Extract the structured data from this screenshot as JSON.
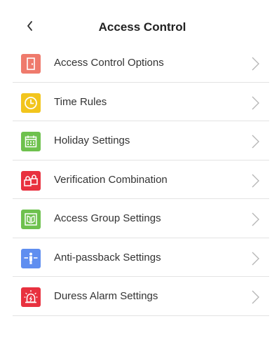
{
  "header": {
    "title": "Access Control",
    "back_icon": "chevron-left-icon"
  },
  "menu": {
    "items": [
      {
        "label": "Access Control Options",
        "icon": "door-icon",
        "color": "#ef7a6c"
      },
      {
        "label": "Time Rules",
        "icon": "clock-icon",
        "color": "#f2c51d"
      },
      {
        "label": "Holiday Settings",
        "icon": "calendar-icon",
        "color": "#6ec14e"
      },
      {
        "label": "Verification Combination",
        "icon": "locks-icon",
        "color": "#e8313f"
      },
      {
        "label": "Access Group Settings",
        "icon": "group-door-icon",
        "color": "#6ec14e"
      },
      {
        "label": "Anti-passback Settings",
        "icon": "anti-passback-icon",
        "color": "#5f8ef0"
      },
      {
        "label": "Duress Alarm Settings",
        "icon": "alarm-icon",
        "color": "#e8313f"
      }
    ],
    "chevron_icon": "chevron-right-icon",
    "divider_color": "#e3e3e3"
  }
}
